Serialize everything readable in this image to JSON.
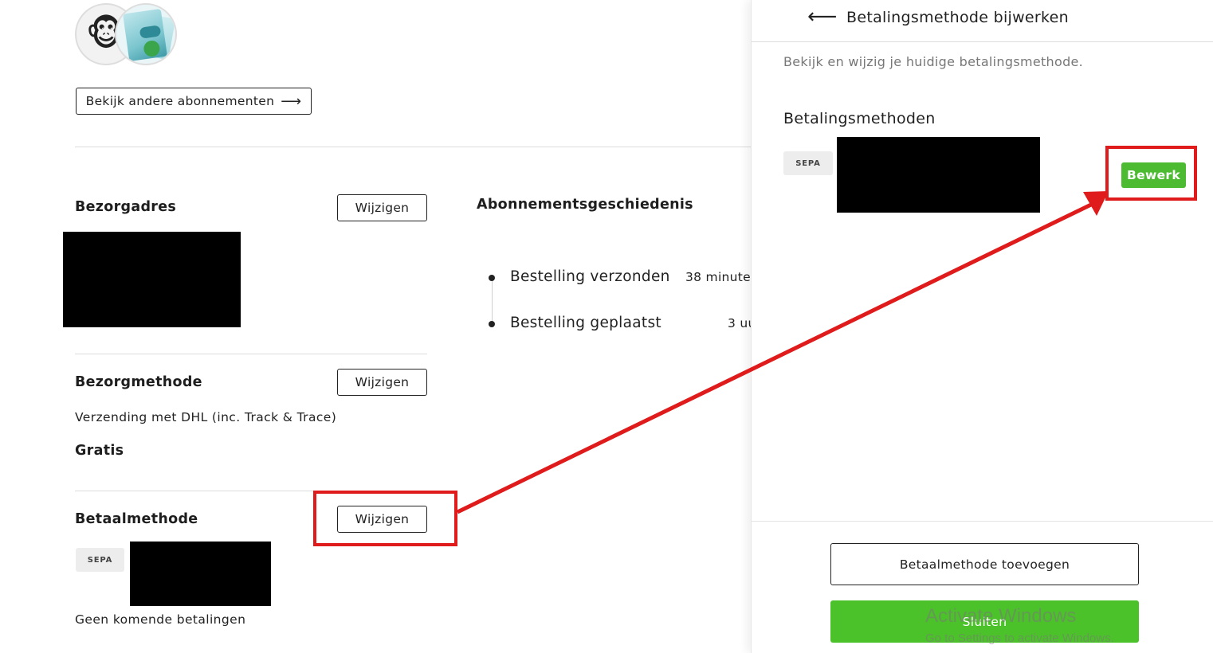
{
  "left": {
    "other_subscriptions_label": "Bekijk andere abonnementen",
    "delivery_address": {
      "title": "Bezorgadres",
      "change_label": "Wijzigen"
    },
    "delivery_method": {
      "title": "Bezorgmethode",
      "change_label": "Wijzigen",
      "method_text": "Verzending met DHL (inc. Track & Trace)",
      "price": "Gratis"
    },
    "payment_method": {
      "title": "Betaalmethode",
      "change_label": "Wijzigen",
      "badge": "SEPA",
      "upcoming": "Geen komende betalingen"
    },
    "history": {
      "title": "Abonnementsgeschiedenis",
      "events": [
        {
          "label": "Bestelling verzonden",
          "time": "38 minute"
        },
        {
          "label": "Bestelling geplaatst",
          "time": "3 uu"
        }
      ]
    }
  },
  "panel": {
    "back_icon": "arrow-left-icon",
    "title": "Betalingsmethode bijwerken",
    "subtitle": "Bekijk en wijzig je huidige betalingsmethode.",
    "methods_title": "Betalingsmethoden",
    "method_badge": "SEPA",
    "edit_label": "Bewerk",
    "add_label": "Betaalmethode toevoegen",
    "close_label": "Sluiten"
  },
  "watermark": {
    "line1": "Activate Windows",
    "line2": "Go to Settings to activate Windows."
  },
  "colors": {
    "accent_green": "#4cbb32",
    "annotation_red": "#e01b1b",
    "redaction": "#000000"
  }
}
